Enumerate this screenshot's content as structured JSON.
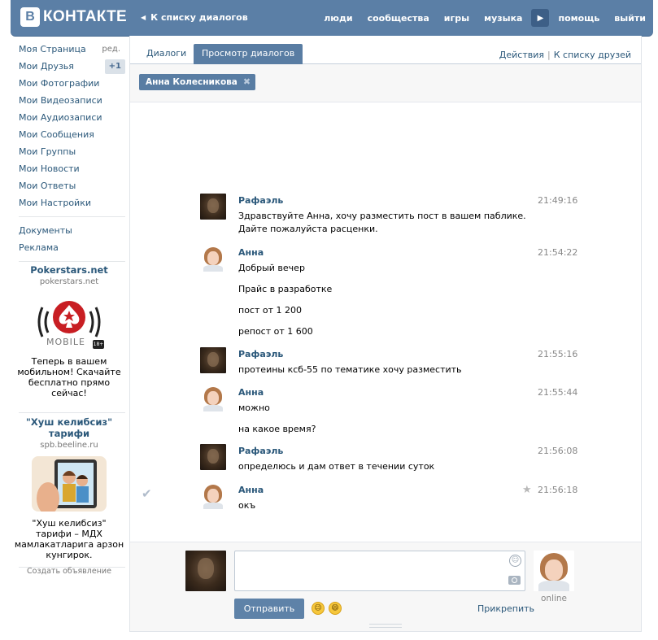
{
  "header": {
    "logo_text": "КОНТАКТЕ",
    "logo_letter": "В",
    "back_link": "К списку диалогов",
    "nav": [
      "люди",
      "сообщества",
      "игры",
      "музыка",
      "помощь",
      "выйти"
    ]
  },
  "sidebar": {
    "items": [
      {
        "label": "Моя Страница",
        "extra": "ред."
      },
      {
        "label": "Мои Друзья",
        "badge": "+1"
      },
      {
        "label": "Мои Фотографии"
      },
      {
        "label": "Мои Видеозаписи"
      },
      {
        "label": "Мои Аудиозаписи"
      },
      {
        "label": "Мои Сообщения"
      },
      {
        "label": "Мои Группы"
      },
      {
        "label": "Мои Новости"
      },
      {
        "label": "Мои Ответы"
      },
      {
        "label": "Мои Настройки"
      }
    ],
    "extra_items": [
      {
        "label": "Документы"
      },
      {
        "label": "Реклама"
      }
    ]
  },
  "ads": [
    {
      "title": "Pokerstars.net",
      "domain": "pokerstars.net",
      "image_caption": "MOBILE",
      "age": "18+",
      "text": "Теперь в вашем мобильном! Скачайте бесплатно прямо сейчас!"
    },
    {
      "title": "\"Хуш келибсиз\" тарифи",
      "domain": "spb.beeline.ru",
      "text": "\"Хуш келибсиз\" тарифи – МДХ мамлакатларига арзон кунгирок."
    }
  ],
  "create_ad": "Создать объявление",
  "tabs": [
    {
      "label": "Диалоги",
      "active": false
    },
    {
      "label": "Просмотр диалогов",
      "active": true
    }
  ],
  "actions": {
    "actions": "Действия",
    "friends": "К списку друзей"
  },
  "peer": {
    "name": "Анна Колесникова"
  },
  "messages": [
    {
      "author": "Рафаэль",
      "time": "21:49:16",
      "lines": [
        "Здравствуйте Анна, хочу разместить пост в вашем паблике. Дайте пожалуйста расценки."
      ]
    },
    {
      "author": "Анна",
      "time": "21:54:22",
      "lines": [
        "Добрый вечер",
        "Прайс в разработке",
        "пост от 1 200",
        "репост от 1 600"
      ]
    },
    {
      "author": "Рафаэль",
      "time": "21:55:16",
      "lines": [
        "протеины ксб-55 по тематике хочу разместить"
      ]
    },
    {
      "author": "Анна",
      "time": "21:55:44",
      "lines": [
        "можно",
        "на какое время?"
      ]
    },
    {
      "author": "Рафаэль",
      "time": "21:56:08",
      "lines": [
        "определюсь и дам ответ в течении суток"
      ]
    },
    {
      "author": "Анна",
      "time": "21:56:18",
      "lines": [
        "окъ"
      ]
    }
  ],
  "composer": {
    "send": "Отправить",
    "attach": "Прикрепить",
    "status": "online"
  },
  "colors": {
    "brand": "#5b7fa6",
    "link": "#2b587a",
    "button": "#5e82a8"
  }
}
